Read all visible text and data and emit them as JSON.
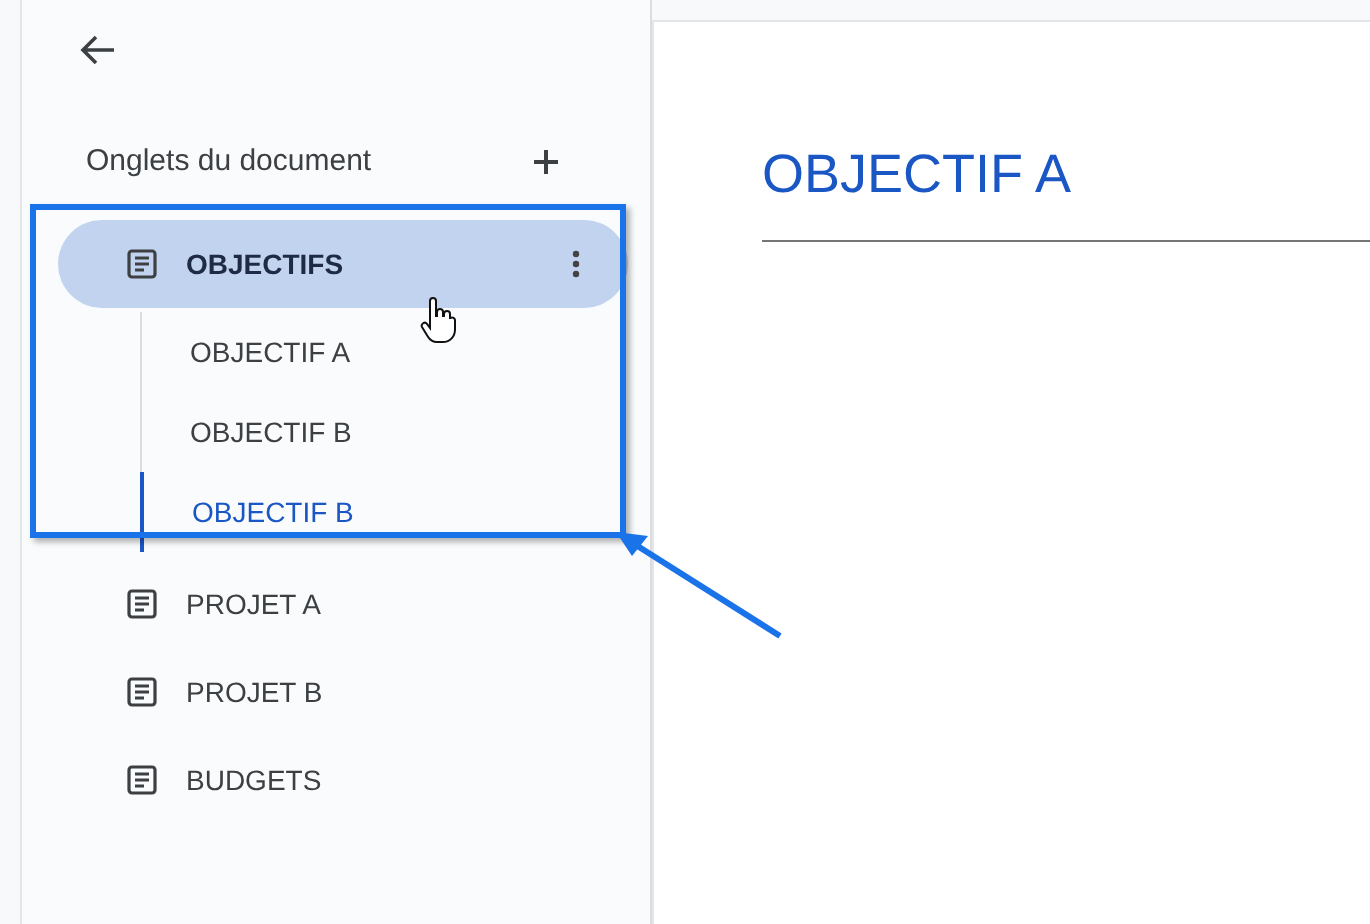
{
  "sidebar": {
    "heading": "Onglets du document",
    "tabs": [
      {
        "label": "OBJECTIFS",
        "selected": true,
        "children": [
          {
            "label": "OBJECTIF A",
            "selected": false
          },
          {
            "label": "OBJECTIF B",
            "selected": false
          },
          {
            "label": "OBJECTIF B",
            "selected": true
          }
        ]
      },
      {
        "label": "PROJET A",
        "selected": false
      },
      {
        "label": "PROJET B",
        "selected": false
      },
      {
        "label": "BUDGETS",
        "selected": false
      }
    ]
  },
  "document": {
    "heading": "OBJECTIF A"
  }
}
